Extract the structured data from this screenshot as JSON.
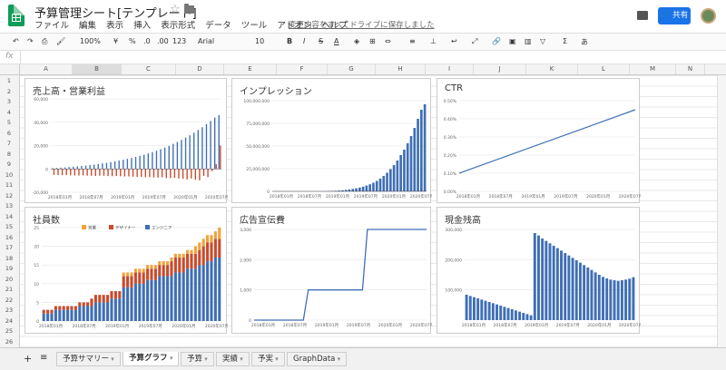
{
  "app": {
    "title": "予算管理シート[テンプレート]",
    "menu": [
      "ファイル",
      "編集",
      "表示",
      "挿入",
      "表示形式",
      "データ",
      "ツール",
      "アドオン",
      "ヘルプ"
    ],
    "save_message": "変更内容をすべてドライブに保存しました",
    "share_label": "共有"
  },
  "toolbar": {
    "zoom": "100%",
    "currency": "¥",
    "percent": "%",
    "decimal_dec": ".0",
    "decimal_inc": ".00",
    "number_format": "123",
    "font": "Arial",
    "font_size": "10",
    "bold": "B",
    "italic": "I",
    "strike": "S",
    "text_color": "A",
    "sigma": "Σ",
    "input": "あ"
  },
  "formula_bar": {
    "fx": "fx",
    "value": ""
  },
  "columns": [
    "A",
    "B",
    "C",
    "D",
    "E",
    "F",
    "G",
    "H",
    "I",
    "J",
    "K",
    "L",
    "M",
    "N"
  ],
  "rows": [
    "1",
    "2",
    "3",
    "4",
    "5",
    "6",
    "7",
    "8",
    "9",
    "10",
    "11",
    "12",
    "13",
    "14",
    "15",
    "16",
    "17",
    "18",
    "19",
    "20",
    "21",
    "22",
    "23",
    "24",
    "25",
    "26"
  ],
  "sheets": [
    {
      "label": "予算サマリー",
      "active": false
    },
    {
      "label": "予算グラフ",
      "active": true
    },
    {
      "label": "予算",
      "active": false
    },
    {
      "label": "実績",
      "active": false
    },
    {
      "label": "予実",
      "active": false
    },
    {
      "label": "GraphData",
      "active": false
    }
  ],
  "colors": {
    "blue": "#3f6fb5",
    "red": "#c94a2c",
    "orange": "#f2a13a",
    "accent": "#1a73e8"
  },
  "chart_data": [
    {
      "type": "bar",
      "title": "売上高・営業利益",
      "yticks": [
        "60,000",
        "40,000",
        "20,000",
        "0",
        "-20,000"
      ],
      "xticks": [
        "2018年01月",
        "2018年07月",
        "2019年01月",
        "2019年07月",
        "2020年01月",
        "2020年07月"
      ],
      "ylim": [
        -20000,
        60000
      ],
      "series": [
        {
          "values": [
            700,
            900,
            1100,
            1300,
            1600,
            1900,
            2200,
            2500,
            2900,
            3300,
            3700,
            4200,
            4700,
            5200,
            5800,
            6400,
            7100,
            7800,
            8600,
            9400,
            10300,
            11200,
            12200,
            13300,
            14400,
            15600,
            16900,
            18300,
            19800,
            21400,
            23100,
            24900,
            26800,
            28800,
            31000,
            33300,
            35700,
            38300,
            41000,
            44000,
            46000
          ]
        },
        {
          "values": [
            -5200,
            -5300,
            -5400,
            -5300,
            -5500,
            -5600,
            -5700,
            -5600,
            -5800,
            -5900,
            -6000,
            -5800,
            -5900,
            -6100,
            -6200,
            -6000,
            -6300,
            -6500,
            -6400,
            -6700,
            -6800,
            -6900,
            -7100,
            -7000,
            -7300,
            -7500,
            -7200,
            -7800,
            -7900,
            -7700,
            -8200,
            -8500,
            -9000,
            -8200,
            -9200,
            -9800,
            -6000,
            -7000,
            -2000,
            4000,
            20000
          ]
        }
      ]
    },
    {
      "type": "bar",
      "title": "インプレッション",
      "yticks": [
        "100,000,000",
        "75,000,000",
        "50,000,000",
        "25,000,000",
        "0"
      ],
      "xticks": [
        "2018年01月",
        "2018年07月",
        "2019年01月",
        "2019年07月",
        "2020年01月",
        "2020年07月"
      ],
      "ylim": [
        0,
        100000000
      ],
      "values": [
        0,
        0,
        0,
        0,
        0,
        0,
        0,
        0,
        0,
        0,
        0,
        0,
        0,
        0,
        0,
        100000,
        200000,
        400000,
        600000,
        900000,
        1200000,
        1600000,
        2100000,
        2700000,
        3400000,
        4200000,
        5200000,
        6400000,
        7800000,
        9500000,
        11500000,
        14000000,
        17000000,
        20500000,
        24500000,
        29000000,
        34000000,
        40000000,
        46000000,
        53000000,
        61000000,
        70000000,
        80000000,
        90000000,
        96000000
      ]
    },
    {
      "type": "line",
      "title": "CTR",
      "yticks": [
        "0.50%",
        "0.40%",
        "0.30%",
        "0.20%",
        "0.10%",
        "0.00%"
      ],
      "xticks": [
        "2018年01月",
        "2018年07月",
        "2019年01月",
        "2019年07月",
        "2020年01月",
        "2020年07月"
      ],
      "ylim": [
        0,
        0.5
      ],
      "x": [
        "2018年01月",
        "2020年12月"
      ],
      "values": [
        0.1,
        0.45
      ]
    },
    {
      "type": "bar",
      "title": "社員数",
      "legend": [
        "営業",
        "デザイナー",
        "エンジニア"
      ],
      "yticks": [
        "25",
        "20",
        "15",
        "10",
        "5",
        "0"
      ],
      "xticks": [
        "2018年01月",
        "2018年07月",
        "2019年01月",
        "2019年07月",
        "2020年01月",
        "2020年07月"
      ],
      "ylim": [
        0,
        25
      ],
      "series": [
        {
          "name": "エンジニア",
          "values": [
            2,
            2,
            2,
            3,
            3,
            3,
            3,
            3,
            3,
            4,
            4,
            4,
            4,
            5,
            5,
            5,
            5,
            6,
            6,
            6,
            9,
            9,
            9,
            10,
            10,
            10,
            11,
            11,
            11,
            12,
            12,
            12,
            12,
            13,
            13,
            13,
            14,
            14,
            14,
            15,
            15,
            16,
            16,
            17,
            17
          ]
        },
        {
          "name": "デザイナー",
          "values": [
            1,
            1,
            1,
            1,
            1,
            1,
            1,
            1,
            1,
            1,
            1,
            1,
            2,
            2,
            2,
            2,
            2,
            2,
            2,
            2,
            3,
            3,
            3,
            3,
            3,
            3,
            3,
            3,
            3,
            3,
            3,
            3,
            4,
            4,
            4,
            4,
            4,
            4,
            4,
            4,
            5,
            5,
            5,
            5,
            5
          ]
        },
        {
          "name": "営業",
          "values": [
            0,
            0,
            0,
            0,
            0,
            0,
            0,
            0,
            0,
            0,
            0,
            0,
            0,
            0,
            0,
            0,
            0,
            0,
            0,
            0,
            1,
            1,
            1,
            1,
            1,
            1,
            1,
            1,
            1,
            1,
            1,
            1,
            1,
            1,
            1,
            1,
            1,
            1,
            2,
            2,
            2,
            2,
            2,
            2,
            3
          ]
        }
      ]
    },
    {
      "type": "line",
      "title": "広告宣伝費",
      "yticks": [
        "3,000",
        "2,000",
        "1,000",
        "0"
      ],
      "xticks": [
        "2018年01月",
        "2018年07月",
        "2019年01月",
        "2019年07月",
        "2020年01月",
        "2020年07月"
      ],
      "ylim": [
        0,
        3000
      ],
      "x": [
        "2018年01月",
        "2018年11月",
        "2018年12月",
        "2019年11月",
        "2019年12月",
        "2020年12月"
      ],
      "values": [
        0,
        0,
        1000,
        1000,
        3000,
        3000
      ]
    },
    {
      "type": "bar",
      "title": "現金残高",
      "yticks": [
        "300,000",
        "200,000",
        "100,000"
      ],
      "xticks": [
        "2018年01月",
        "2018年07月",
        "2019年01月",
        "2019年07月",
        "2020年01月",
        "2020年07月"
      ],
      "ylim": [
        0,
        300000
      ],
      "values": [
        84000,
        80000,
        76000,
        72000,
        68000,
        64000,
        60000,
        56000,
        52000,
        48000,
        44000,
        40000,
        36000,
        32000,
        28000,
        24000,
        20000,
        16000,
        288000,
        280000,
        270000,
        262000,
        254000,
        246000,
        238000,
        230000,
        222000,
        214000,
        206000,
        198000,
        190000,
        182000,
        174000,
        166000,
        158000,
        150000,
        143000,
        138000,
        134000,
        132000,
        130000,
        132000,
        134000,
        137000,
        142000
      ]
    }
  ]
}
